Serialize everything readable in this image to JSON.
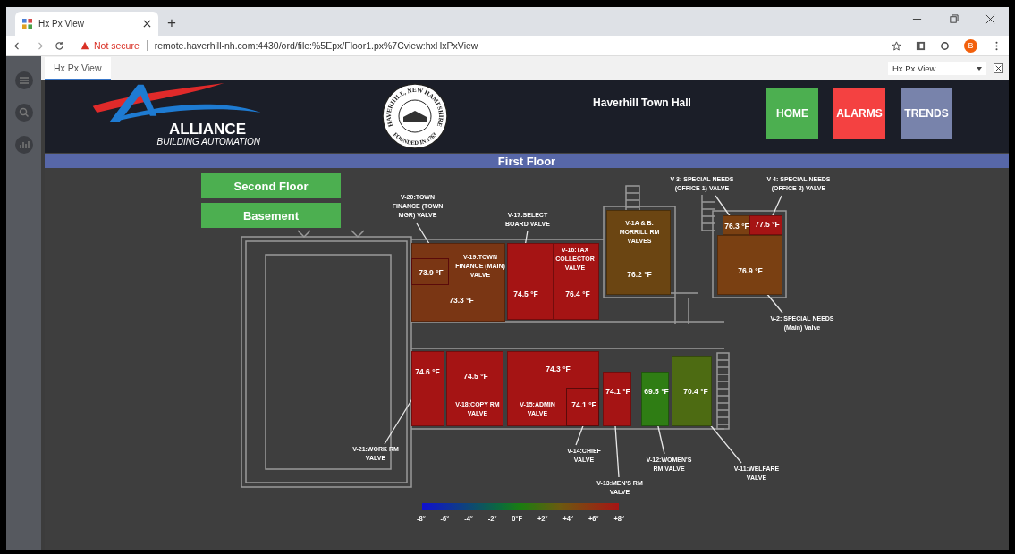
{
  "browser": {
    "tab": {
      "title": "Hx Px View",
      "selected": true
    },
    "new_tab": "+",
    "security": "Not secure",
    "url": "remote.haverhill-nh.com:4430/ord/file:%5Epx/Floor1.px%7Cview:hxHxPxView",
    "profile": "B"
  },
  "view_tab": {
    "label": "Hx Px View",
    "selected": true
  },
  "view_select": {
    "value": "Hx Px View"
  },
  "header": {
    "logo": {
      "name": "ALLIANCE",
      "tagline": "BUILDING AUTOMATION"
    },
    "seal": {
      "top": "HAVERHILL, NEW HAMPSHIRE",
      "bottom": "FOUNDED IN 1763"
    },
    "title": "Haverhill Town Hall",
    "nav": [
      {
        "label": "HOME",
        "color": "#4caf50"
      },
      {
        "label": "ALARMS",
        "color": "#f44141"
      },
      {
        "label": "TRENDS",
        "color": "#7883ab"
      }
    ]
  },
  "floor_title": "First Floor",
  "floor_buttons": [
    "Second Floor",
    "Basement"
  ],
  "rooms": [
    {
      "temperature": "73.9 °F",
      "color": "#7a3614"
    },
    {
      "temperature": "73.3 °F",
      "color": "#7a3614"
    },
    {
      "temperature": "74.5 °F",
      "color": "#a51414"
    },
    {
      "temperature": "76.4 °F",
      "color": "#a51414"
    },
    {
      "temperature": "76.2 °F",
      "color": "#6b4512"
    },
    {
      "temperature": "76.3 °F",
      "color": "#7a4012"
    },
    {
      "temperature": "77.5 °F",
      "color": "#a51414"
    },
    {
      "temperature": "76.9 °F",
      "color": "#7a4012"
    },
    {
      "temperature": "74.6 °F",
      "color": "#a51414"
    },
    {
      "temperature": "74.5 °F",
      "color": "#a51414"
    },
    {
      "temperature": "74.3 °F",
      "color": "#a51414"
    },
    {
      "temperature": "74.1 °F",
      "color": "#a51414"
    },
    {
      "temperature": "74.1 °F",
      "color": "#a51414"
    },
    {
      "temperature": "69.5 °F",
      "color": "#2f7d14"
    },
    {
      "temperature": "70.4 °F",
      "color": "#4d6b12"
    }
  ],
  "valve_labels": [
    "V-20:TOWN FINANCE (TOWN MGR) VALVE",
    "V-19:TOWN FINANCE (MAIN) VALVE",
    "V-17:SELECT BOARD VALVE",
    "V-16:TAX COLLECTOR VALVE",
    "V-1A & B: MORRILL RM VALVES",
    "V-3: SPECIAL NEEDS (OFFICE 1) VALVE",
    "V-4: SPECIAL NEEDS (OFFICE 2) VALVE",
    "V-2: SPECIAL NEEDS (Main) Valve",
    "V-21:WORK RM VALVE",
    "V-18:COPY RM VALVE",
    "V-15:ADMIN VALVE",
    "V-14:CHIEF VALVE",
    "V-13:MEN'S RM VALVE",
    "V-12:WOMEN'S RM VALVE",
    "V-11:WELFARE VALVE"
  ],
  "legend": [
    "-8°",
    "-6°",
    "-4°",
    "-2°",
    "0°F",
    "+2°",
    "+4°",
    "+6°",
    "+8°"
  ]
}
